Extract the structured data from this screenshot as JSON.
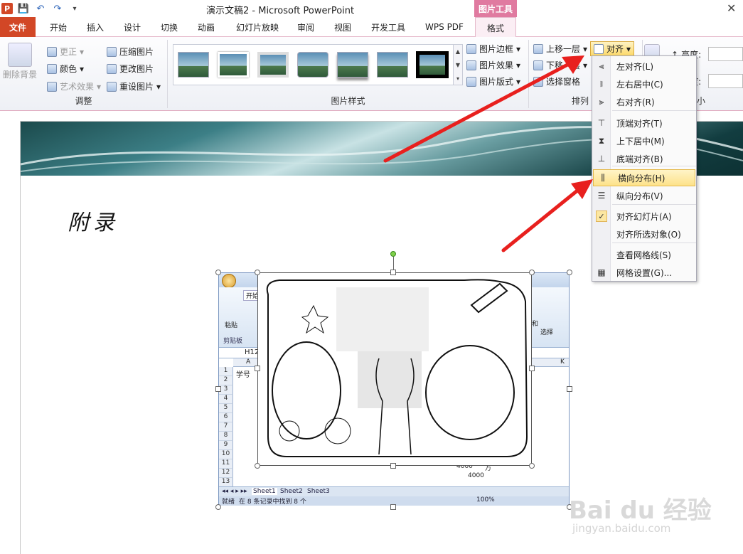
{
  "window": {
    "title": "演示文稿2 - Microsoft PowerPoint",
    "contextual_tool": "图片工具",
    "close_glyph": "✕"
  },
  "qat": {
    "logo": "P",
    "save": "💾",
    "undo": "↶",
    "redo": "↷",
    "customize": "▾"
  },
  "tabs": [
    {
      "label": "文件"
    },
    {
      "label": "开始"
    },
    {
      "label": "插入"
    },
    {
      "label": "设计"
    },
    {
      "label": "切换"
    },
    {
      "label": "动画"
    },
    {
      "label": "幻灯片放映"
    },
    {
      "label": "审阅"
    },
    {
      "label": "视图"
    },
    {
      "label": "开发工具"
    },
    {
      "label": "WPS PDF"
    },
    {
      "label": "格式"
    }
  ],
  "ribbon": {
    "adjust": {
      "label": "调整",
      "remove_bg": "删除背景",
      "correct": "更正",
      "color": "颜色",
      "artistic": "艺术效果",
      "compress": "压缩图片",
      "change": "更改图片",
      "reset": "重设图片"
    },
    "styles": {
      "label": "图片样式",
      "border": "图片边框",
      "effects": "图片效果",
      "layout": "图片版式"
    },
    "arrange": {
      "label": "排列",
      "bring_forward": "上移一层",
      "send_backward": "下移一层",
      "selection_pane": "选择窗格",
      "align": "对齐",
      "align_caret": "▾"
    },
    "size": {
      "label": "小",
      "height": "高度:",
      "width": "宽度:"
    }
  },
  "align_menu": {
    "items": [
      {
        "label": "左对齐(L)",
        "icon": "align-left-icon"
      },
      {
        "label": "左右居中(C)",
        "icon": "align-center-icon"
      },
      {
        "label": "右对齐(R)",
        "icon": "align-right-icon"
      },
      {
        "label": "顶端对齐(T)",
        "icon": "align-top-icon"
      },
      {
        "label": "上下居中(M)",
        "icon": "align-middle-icon"
      },
      {
        "label": "底端对齐(B)",
        "icon": "align-bottom-icon"
      },
      {
        "label": "横向分布(H)",
        "icon": "distribute-horizontal-icon",
        "highlighted": true
      },
      {
        "label": "纵向分布(V)",
        "icon": "distribute-vertical-icon"
      },
      {
        "label": "对齐幻灯片(A)",
        "icon": "check-icon",
        "checked": true
      },
      {
        "label": "对齐所选对象(O)",
        "icon": ""
      },
      {
        "label": "查看网格线(S)",
        "icon": ""
      },
      {
        "label": "网格设置(G)...",
        "icon": "grid-icon"
      }
    ]
  },
  "slide": {
    "heading": "附录"
  },
  "excel_snapshot": {
    "tab_label": "开始",
    "paste": "粘贴",
    "clipboard": "剪贴板",
    "name_box": "H12",
    "col_a": "A",
    "col_k": "K",
    "row1_cell": "学号",
    "rows": [
      "1",
      "2",
      "3",
      "4",
      "5",
      "6",
      "7",
      "8",
      "9",
      "10",
      "11",
      "12",
      "13"
    ],
    "val_row11": "4000",
    "val_row11_unit": "万",
    "val_row12": "4000",
    "right_labels": [
      "和",
      "选择"
    ],
    "sheets": [
      "Sheet1",
      "Sheet2",
      "Sheet3"
    ],
    "status_ready": "就绪",
    "status_found": "在 8 条记录中找到 8 个",
    "zoom": "100%"
  },
  "watermark": {
    "brand": "Bai du 经验",
    "url": "jingyan.baidu.com"
  },
  "colors": {
    "file_tab": "#d24726",
    "context_tab": "#e07aa0",
    "highlight": "#fde28a",
    "arrow": "#e8201e"
  }
}
